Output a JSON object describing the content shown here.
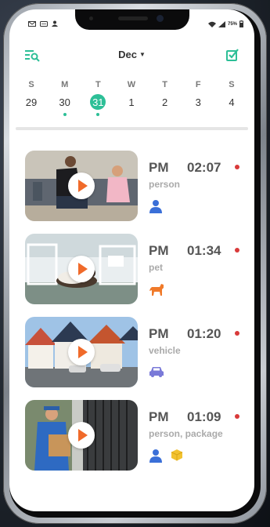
{
  "statusbar": {
    "battery": "75%"
  },
  "header": {
    "month": "Dec",
    "filter_icon": "list-search-icon",
    "edit_icon": "edit-check-icon"
  },
  "week": {
    "days": [
      {
        "name": "S",
        "date": "29",
        "dot": false,
        "selected": false
      },
      {
        "name": "M",
        "date": "30",
        "dot": true,
        "selected": false
      },
      {
        "name": "T",
        "date": "31",
        "dot": true,
        "selected": true
      },
      {
        "name": "W",
        "date": "1",
        "dot": false,
        "selected": false
      },
      {
        "name": "T",
        "date": "2",
        "dot": false,
        "selected": false
      },
      {
        "name": "F",
        "date": "3",
        "dot": false,
        "selected": false
      },
      {
        "name": "S",
        "date": "4",
        "dot": false,
        "selected": false
      }
    ]
  },
  "events": [
    {
      "ampm": "PM",
      "time": "02:07",
      "tags": "person",
      "icons": [
        "person-icon"
      ],
      "thumbnail": "living-room"
    },
    {
      "ampm": "PM",
      "time": "01:34",
      "tags": "pet",
      "icons": [
        "dog-icon"
      ],
      "thumbnail": "patio-dog"
    },
    {
      "ampm": "PM",
      "time": "01:20",
      "tags": "vehicle",
      "icons": [
        "car-icon"
      ],
      "thumbnail": "houses-street"
    },
    {
      "ampm": "PM",
      "time": "01:09",
      "tags": "person, package",
      "icons": [
        "person-icon",
        "package-icon"
      ],
      "thumbnail": "delivery-gate"
    }
  ],
  "colors": {
    "accent": "#2dbf97",
    "record_dot": "#d93a3a",
    "play": "#f06a2a",
    "person_icon": "#3a6fd8",
    "dog_icon": "#f07a2a",
    "car_icon": "#7a7ad8",
    "package_icon": "#f2c230"
  }
}
